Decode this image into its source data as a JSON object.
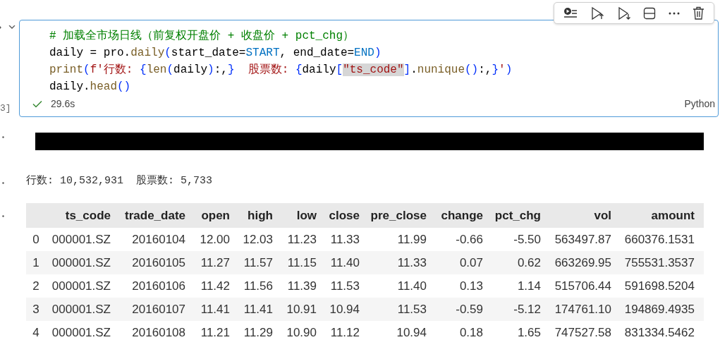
{
  "cell": {
    "execution_count": "3]",
    "code_lines": [
      [
        {
          "kind": "comment",
          "text": "# 加载全市场日线（前复权开盘价 + 收盘价 + pct_chg）"
        }
      ],
      [
        {
          "kind": "text",
          "text": "daily = pro."
        },
        {
          "kind": "func",
          "text": "daily"
        },
        {
          "kind": "bracket",
          "text": "("
        },
        {
          "kind": "text",
          "text": "start_date="
        },
        {
          "kind": "const",
          "text": "START"
        },
        {
          "kind": "text",
          "text": ", end_date="
        },
        {
          "kind": "const",
          "text": "END"
        },
        {
          "kind": "bracket",
          "text": ")"
        }
      ],
      [
        {
          "kind": "func",
          "text": "print"
        },
        {
          "kind": "bracket",
          "text": "("
        },
        {
          "kind": "str",
          "text": "f'行数: "
        },
        {
          "kind": "bracket2",
          "text": "{"
        },
        {
          "kind": "func",
          "text": "len"
        },
        {
          "kind": "bracket",
          "text": "("
        },
        {
          "kind": "text",
          "text": "daily"
        },
        {
          "kind": "bracket",
          "text": ")"
        },
        {
          "kind": "text",
          "text": ":,"
        },
        {
          "kind": "bracket2",
          "text": "}"
        },
        {
          "kind": "str",
          "text": "  股票数: "
        },
        {
          "kind": "bracket2",
          "text": "{"
        },
        {
          "kind": "text",
          "text": "daily"
        },
        {
          "kind": "bracket",
          "text": "["
        },
        {
          "kind": "str_hl",
          "text": "\"ts_code\""
        },
        {
          "kind": "bracket",
          "text": "]"
        },
        {
          "kind": "text",
          "text": "."
        },
        {
          "kind": "func",
          "text": "nunique"
        },
        {
          "kind": "bracket",
          "text": "()"
        },
        {
          "kind": "text",
          "text": ":,"
        },
        {
          "kind": "bracket2",
          "text": "}"
        },
        {
          "kind": "str",
          "text": "'"
        },
        {
          "kind": "bracket2",
          "text": ")"
        }
      ],
      [
        {
          "kind": "text",
          "text": "daily."
        },
        {
          "kind": "func",
          "text": "head"
        },
        {
          "kind": "bracket",
          "text": "()"
        }
      ]
    ],
    "status": {
      "succeeded": true,
      "duration": "29.6s",
      "language": "Python"
    }
  },
  "output": {
    "stdout": "行数: 10,532,931  股票数: 5,733",
    "table": {
      "columns": [
        "",
        "ts_code",
        "trade_date",
        "open",
        "high",
        "low",
        "close",
        "pre_close",
        "change",
        "pct_chg",
        "vol",
        "amount"
      ],
      "rows": [
        [
          "0",
          "000001.SZ",
          "20160104",
          "12.00",
          "12.03",
          "11.23",
          "11.33",
          "11.99",
          "-0.66",
          "-5.50",
          "563497.87",
          "660376.1531"
        ],
        [
          "1",
          "000001.SZ",
          "20160105",
          "11.27",
          "11.57",
          "11.15",
          "11.40",
          "11.33",
          "0.07",
          "0.62",
          "663269.95",
          "755531.3537"
        ],
        [
          "2",
          "000001.SZ",
          "20160106",
          "11.42",
          "11.56",
          "11.39",
          "11.53",
          "11.40",
          "0.13",
          "1.14",
          "515706.44",
          "591698.5204"
        ],
        [
          "3",
          "000001.SZ",
          "20160107",
          "11.41",
          "11.41",
          "10.91",
          "10.94",
          "11.53",
          "-0.59",
          "-5.12",
          "174761.10",
          "194869.4935"
        ],
        [
          "4",
          "000001.SZ",
          "20160108",
          "11.21",
          "11.29",
          "10.90",
          "11.12",
          "10.94",
          "0.18",
          "1.65",
          "747527.58",
          "831334.5462"
        ]
      ]
    }
  }
}
